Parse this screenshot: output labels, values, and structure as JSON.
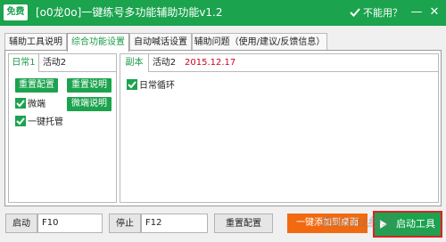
{
  "titlebar": {
    "badge": "免费",
    "title": "[o0龙0o]一键练号多功能辅助功能v1.2",
    "help": "不能用？",
    "min_label": "—",
    "close_label": "✕"
  },
  "main_tabs": [
    "辅助工具说明",
    "综合功能设置",
    "自动喊话设置",
    "辅助问题（使用/建议/反馈信息）"
  ],
  "left_panel": {
    "tabs": [
      "日常1",
      "活动2"
    ],
    "buttons": [
      "重置配置",
      "重置说明",
      "微端说明"
    ],
    "checkboxes": [
      "微端",
      "一键托管"
    ]
  },
  "right_panel": {
    "tabs": [
      "副本",
      "活动2"
    ],
    "date": "2015.12.17",
    "checkboxes": [
      "日常循环"
    ]
  },
  "bottom": {
    "start_label": "启动",
    "start_key": "F10",
    "stop_label": "停止",
    "stop_key": "F12",
    "reset_label": "重置配置",
    "add_desktop_label": "一键添加到桌面",
    "launch_label": "启动工具"
  },
  "watermark": {
    "main": "Baidu经验",
    "sub": "jingyan.baidu.com"
  },
  "colors": {
    "brand_green": "#1ba34e",
    "accent_orange": "#f26a10",
    "date_red": "#d0021b",
    "highlight_red": "#e02020"
  }
}
